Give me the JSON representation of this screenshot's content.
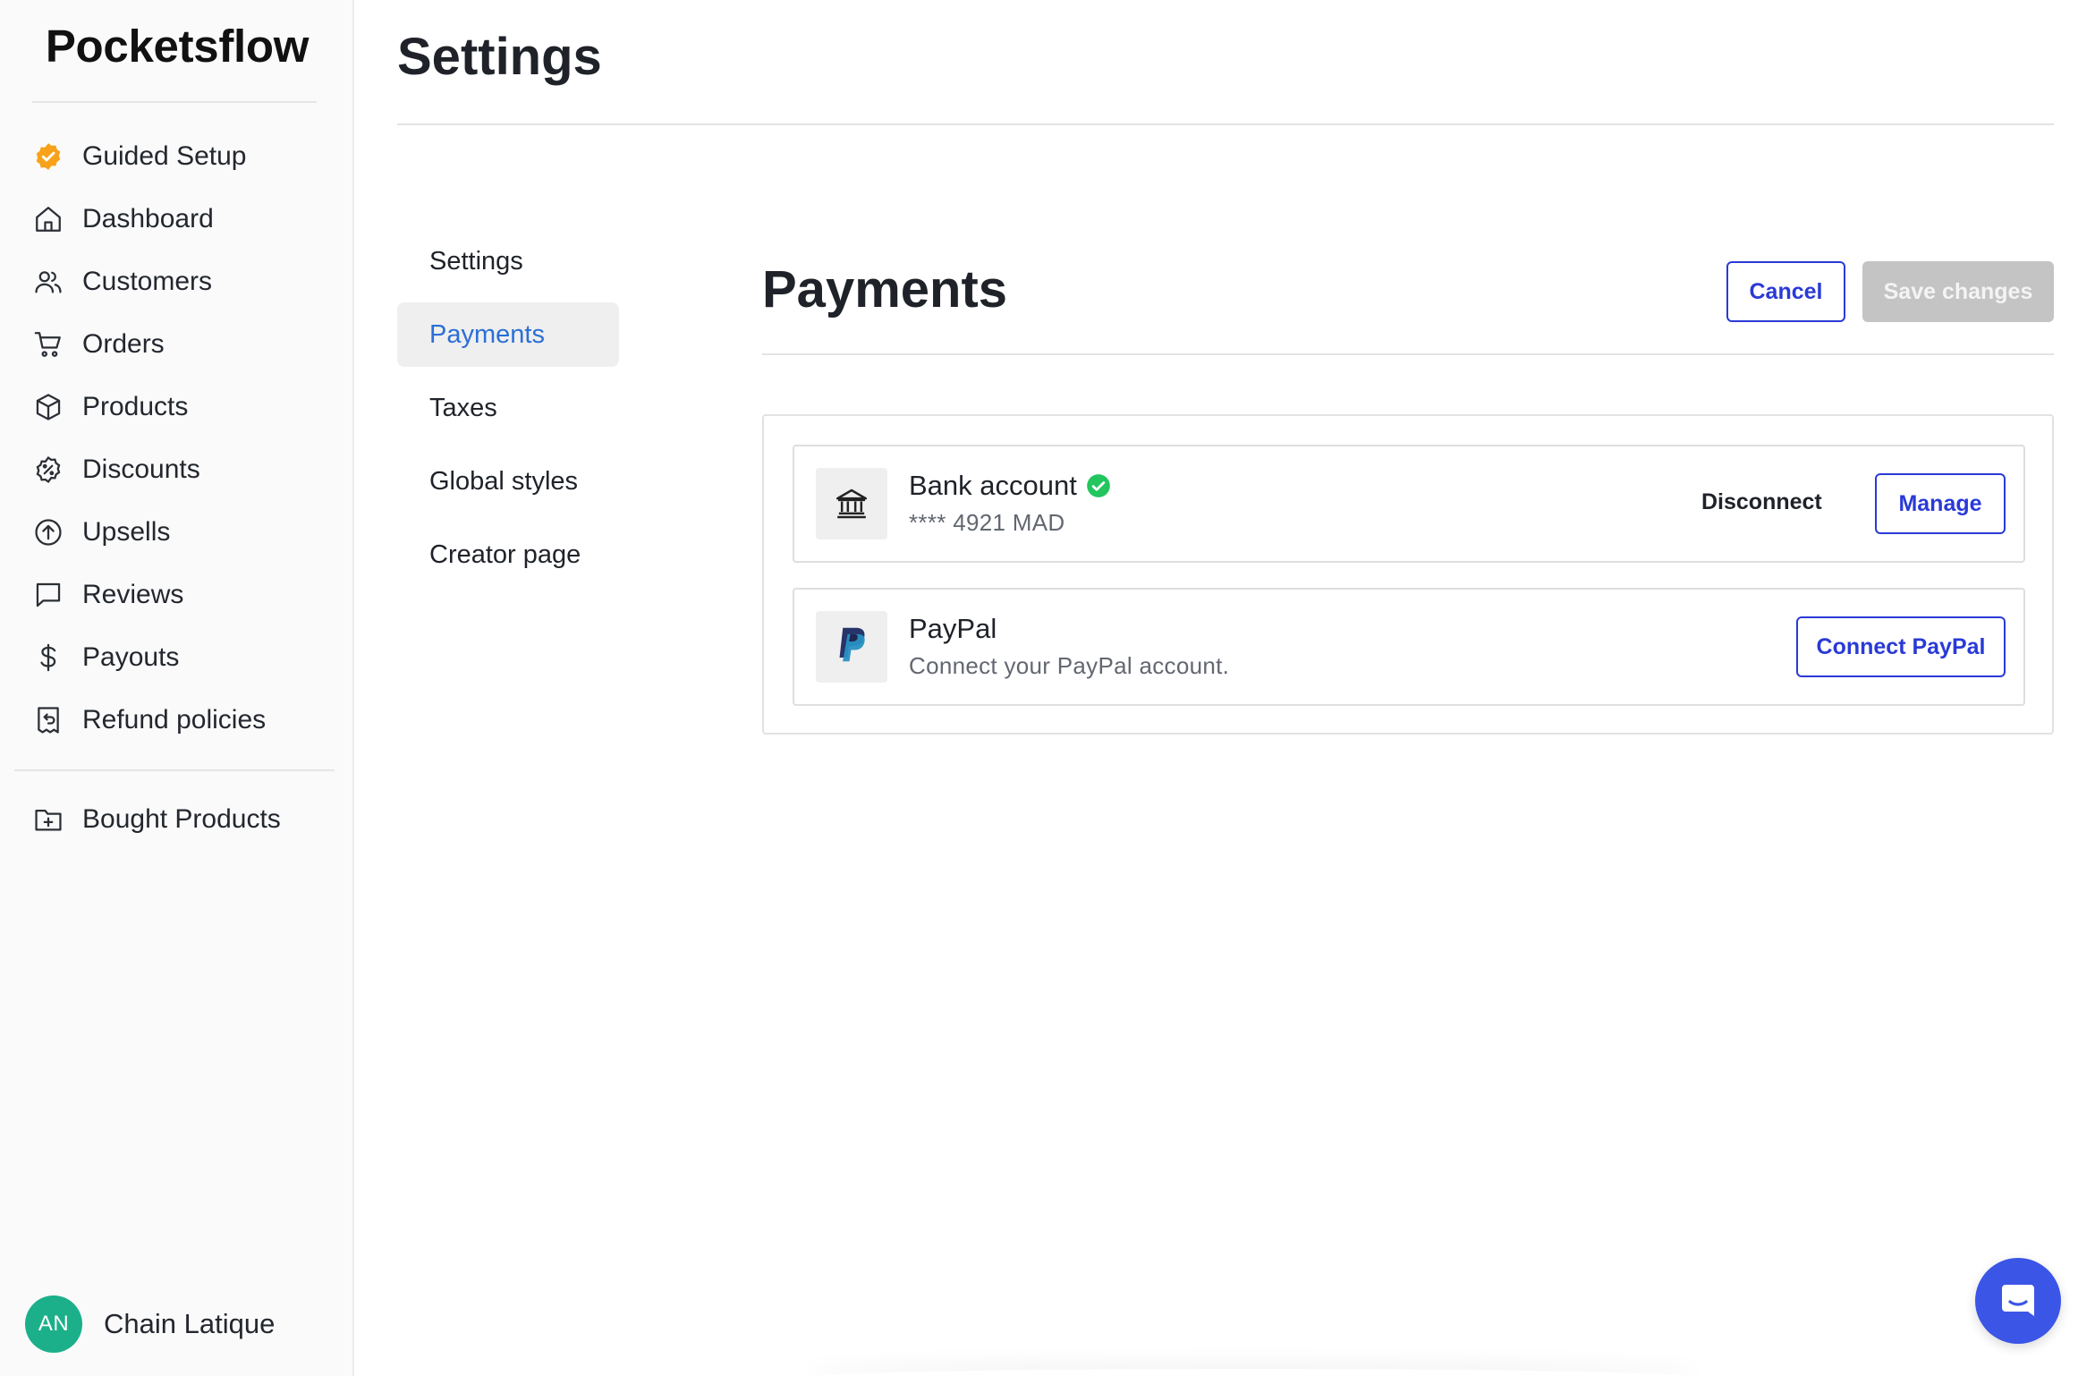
{
  "app": {
    "brand": "Pocketsflow"
  },
  "sidebar": {
    "items": [
      {
        "label": "Guided Setup",
        "icon": "badge-check-icon"
      },
      {
        "label": "Dashboard",
        "icon": "home-icon"
      },
      {
        "label": "Customers",
        "icon": "users-icon"
      },
      {
        "label": "Orders",
        "icon": "cart-icon"
      },
      {
        "label": "Products",
        "icon": "box-icon"
      },
      {
        "label": "Discounts",
        "icon": "discount-icon"
      },
      {
        "label": "Upsells",
        "icon": "arrow-up-circle-icon"
      },
      {
        "label": "Reviews",
        "icon": "message-icon"
      },
      {
        "label": "Payouts",
        "icon": "dollar-icon"
      },
      {
        "label": "Refund policies",
        "icon": "refund-receipt-icon"
      }
    ],
    "bottom_items": [
      {
        "label": "Bought Products",
        "icon": "folder-plus-icon"
      }
    ],
    "user": {
      "initials": "AN",
      "name": "Chain Latique"
    }
  },
  "page": {
    "title": "Settings"
  },
  "subnav": {
    "items": [
      "Settings",
      "Payments",
      "Taxes",
      "Global styles",
      "Creator page"
    ],
    "active": "Payments"
  },
  "payments": {
    "title": "Payments",
    "cancel_label": "Cancel",
    "save_label": "Save changes",
    "bank": {
      "title": "Bank account",
      "detail": "**** 4921 MAD",
      "disconnect_label": "Disconnect",
      "manage_label": "Manage"
    },
    "paypal": {
      "title": "PayPal",
      "detail": "Connect your PayPal account.",
      "connect_label": "Connect PayPal"
    }
  },
  "colors": {
    "accent": "#2a3ad6",
    "active_link": "#2b6fd6",
    "guided_setup_badge": "#f7a21a",
    "verified_green": "#22c55e",
    "avatar": "#1cb08a",
    "chat_bubble": "#3b55e6"
  }
}
